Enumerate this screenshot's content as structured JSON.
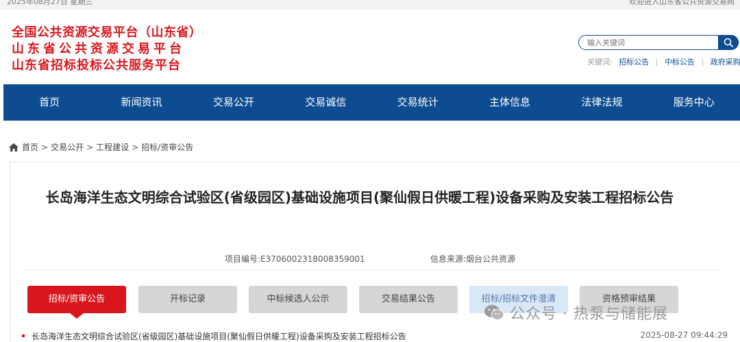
{
  "topbar": {
    "date": "2025年08月27日 星期三",
    "welcome": "欢迎进入山东省公共资源交易网"
  },
  "logo": {
    "line1": "全国公共资源交易平台（山东省）",
    "line2": "山东省公共资源交易平台",
    "line3": "山东省招标投标公共服务平台"
  },
  "search": {
    "placeholder": "输入关键词",
    "keywords_label": "关键词:",
    "keywords": [
      "招标公告",
      "中标公告",
      "政府采购"
    ]
  },
  "nav": {
    "items": [
      "首页",
      "新闻资讯",
      "交易公开",
      "交易诚信",
      "交易统计",
      "主体信息",
      "法律法规",
      "服务中心"
    ]
  },
  "breadcrumb": {
    "items": [
      "首页",
      "交易公开",
      "工程建设",
      "招标/资审公告"
    ]
  },
  "article": {
    "title": "长岛海洋生态文明综合试验区(省级园区)基础设施项目(聚仙假日供暖工程)设备采购及安装工程招标公告",
    "project_code_label": "项目编号:",
    "project_code": "E3706002318008359001",
    "source_label": "信息来源:",
    "source": "烟台公共资源"
  },
  "tabs": {
    "items": [
      "招标/资审公告",
      "开标记录",
      "中标候选人公示",
      "交易结果公告",
      "招标/招标文件澄清",
      "资格预审结果"
    ]
  },
  "watermark": {
    "text": "公众号 · 热泵与储能展"
  },
  "list": {
    "rows": [
      {
        "text": "长岛海洋生态文明综合试验区(省级园区)基础设施项目(聚仙假日供暖工程)设备采购及安装工程招标公告",
        "time": "2025-08-27 09:44:29"
      }
    ]
  },
  "colors": {
    "brand_red": "#d9161c",
    "nav_blue": "#0d4c91"
  }
}
